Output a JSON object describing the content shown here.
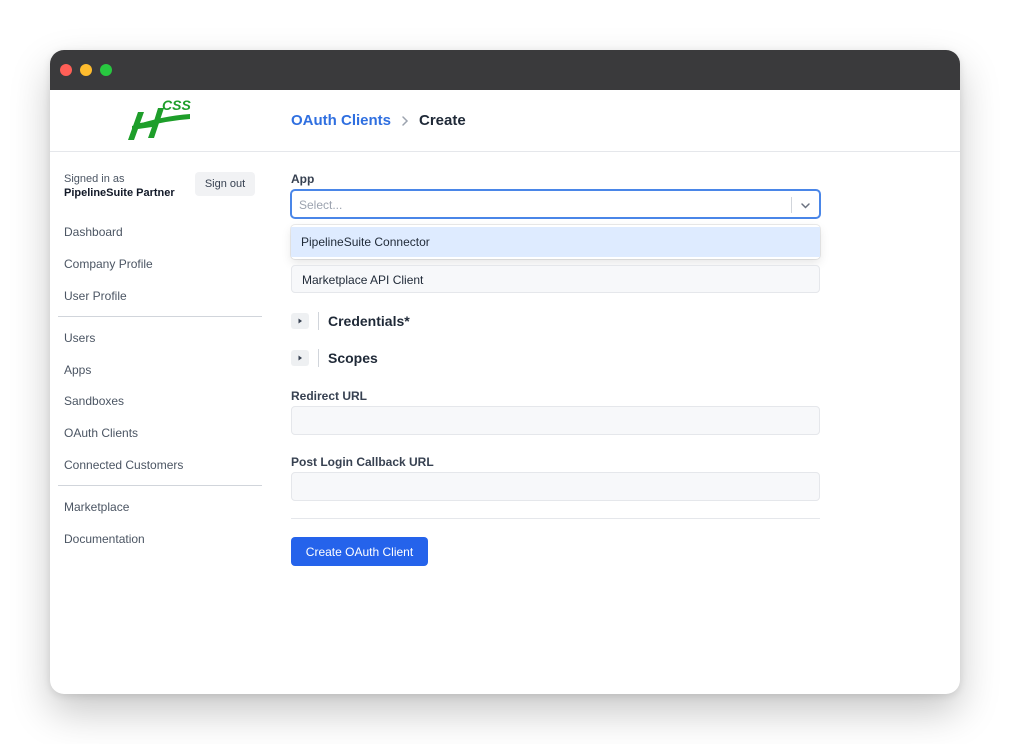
{
  "window": {
    "controls": [
      "close-button",
      "minimize-button",
      "maximize-button"
    ]
  },
  "logo": {
    "text": "CSS",
    "letter": "H"
  },
  "breadcrumb": {
    "parent": "OAuth Clients",
    "current": "Create"
  },
  "sidebar": {
    "signed_in_label": "Signed in as",
    "signed_in_name": "PipelineSuite Partner",
    "sign_out_label": "Sign out",
    "group1": [
      "Dashboard",
      "Company Profile",
      "User Profile"
    ],
    "group2": [
      "Users",
      "Apps",
      "Sandboxes",
      "OAuth Clients",
      "Connected Customers"
    ],
    "group3": [
      "Marketplace",
      "Documentation"
    ]
  },
  "form": {
    "app_label": "App",
    "app_select_placeholder": "Select...",
    "app_dropdown_options": [
      "PipelineSuite Connector"
    ],
    "app_below_item": "Marketplace API Client",
    "credentials_label": "Credentials*",
    "scopes_label": "Scopes",
    "redirect_label": "Redirect URL",
    "redirect_value": "",
    "callback_label": "Post Login Callback URL",
    "callback_value": "",
    "submit_label": "Create OAuth Client"
  },
  "colors": {
    "accent": "#2563eb",
    "link": "#2f6fe0",
    "option_highlight": "#deebff",
    "logo_green": "#1e9e2a"
  }
}
